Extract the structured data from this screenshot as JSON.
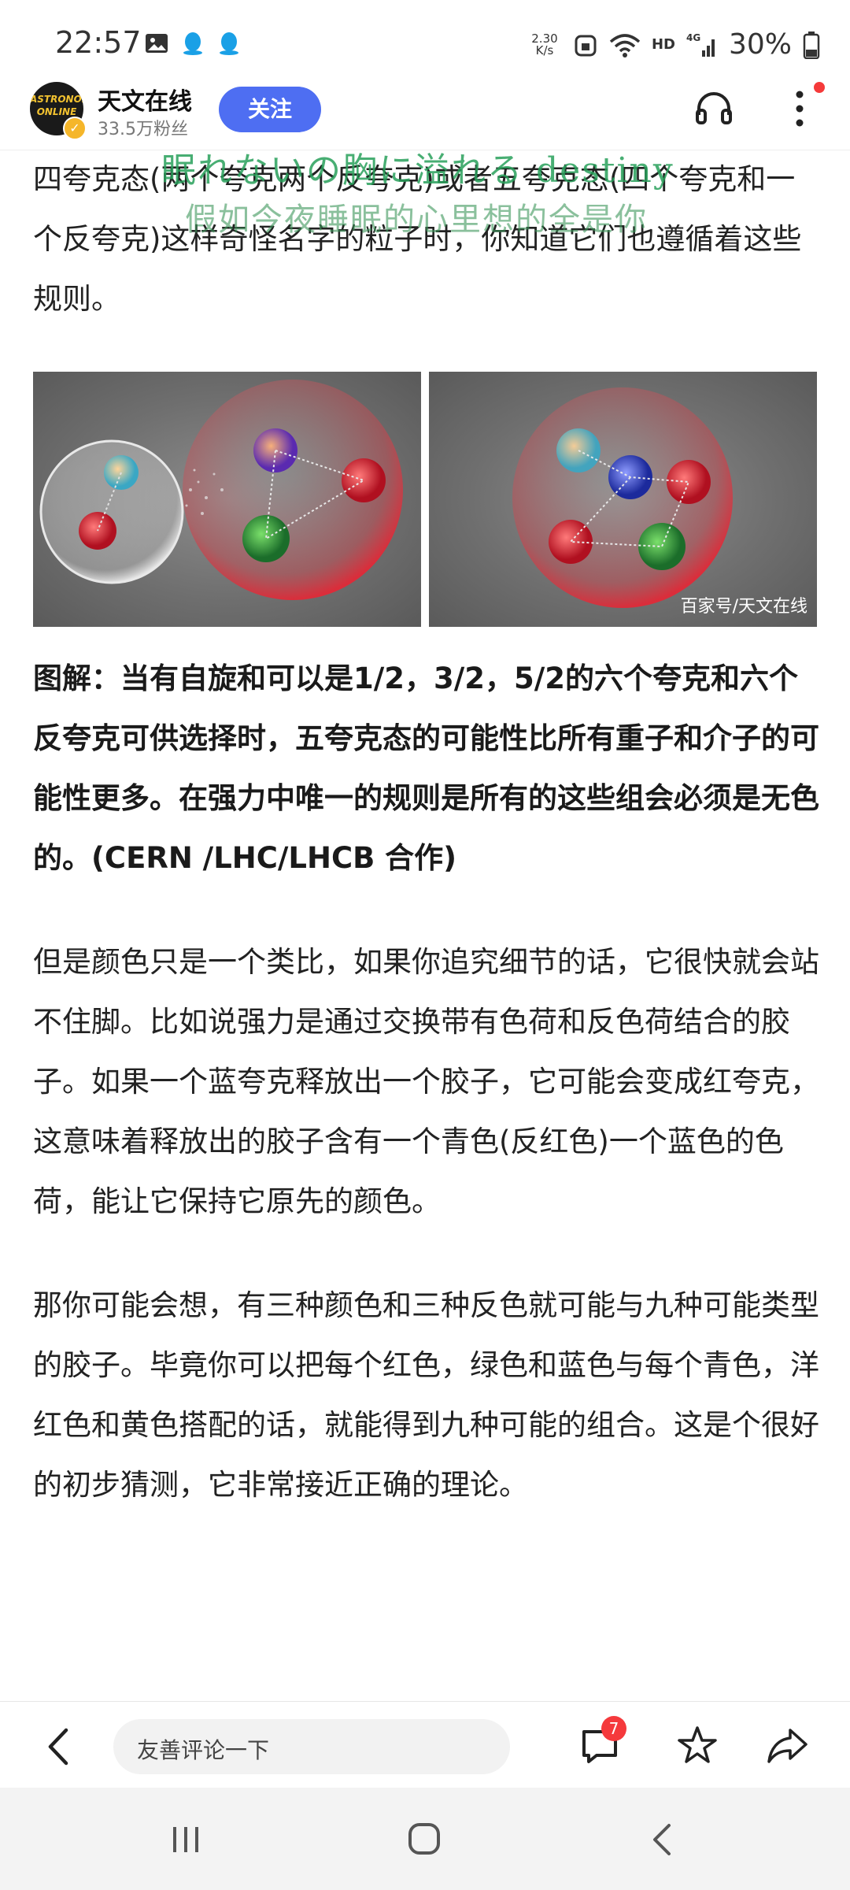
{
  "status_bar": {
    "time": "22:57",
    "net_speed_value": "2.30",
    "net_speed_unit": "K/s",
    "hd": "HD",
    "signal": "4G",
    "battery": "30%"
  },
  "header": {
    "account_name": "天文在线",
    "fans": "33.5万粉丝",
    "follow_label": "关注",
    "avatar_text_1": "ASTRONOM",
    "avatar_text_2": "ONLINE"
  },
  "watermark": {
    "line1": "眠れないの胸に溢れる destiny",
    "line2": "假如今夜睡眠的心里想的全是你"
  },
  "article": {
    "para1": "四夸克态(两个夸克两个反夸克)或者五夸克态(四个夸克和一个反夸克)这样奇怪名字的粒子时，你知道它们也遵循着这些规则。",
    "image_credit": "百家号/天文在线",
    "caption": "图解：当有自旋和可以是1/2，3/2，5/2的六个夸克和六个反夸克可供选择时，五夸克态的可能性比所有重子和介子的可能性更多。在强力中唯一的规则是所有的这些组会必须是无色的。(CERN /LHC/LHCB 合作)",
    "para2": "但是颜色只是一个类比，如果你追究细节的话，它很快就会站不住脚。比如说强力是通过交换带有色荷和反色荷结合的胶子。如果一个蓝夸克释放出一个胶子，它可能会变成红夸克，这意味着释放出的胶子含有一个青色(反红色)一个蓝色的色荷，能让它保持它原先的颜色。",
    "para3": "那你可能会想，有三种颜色和三种反色就可能与九种可能类型的胶子。毕竟你可以把每个红色，绿色和蓝色与每个青色，洋红色和黄色搭配的话，就能得到九种可能的组合。这是个很好的初步猜测，它非常接近正确的理论。"
  },
  "bottom_bar": {
    "comment_placeholder": "友善评论一下",
    "comment_count": "7"
  },
  "colors": {
    "follow_bg": "#4e6ef2",
    "badge": "#f5393c",
    "quark_red": "#c81e2e",
    "quark_green": "#1f8a3a",
    "quark_blue": "#2a3fb0"
  }
}
